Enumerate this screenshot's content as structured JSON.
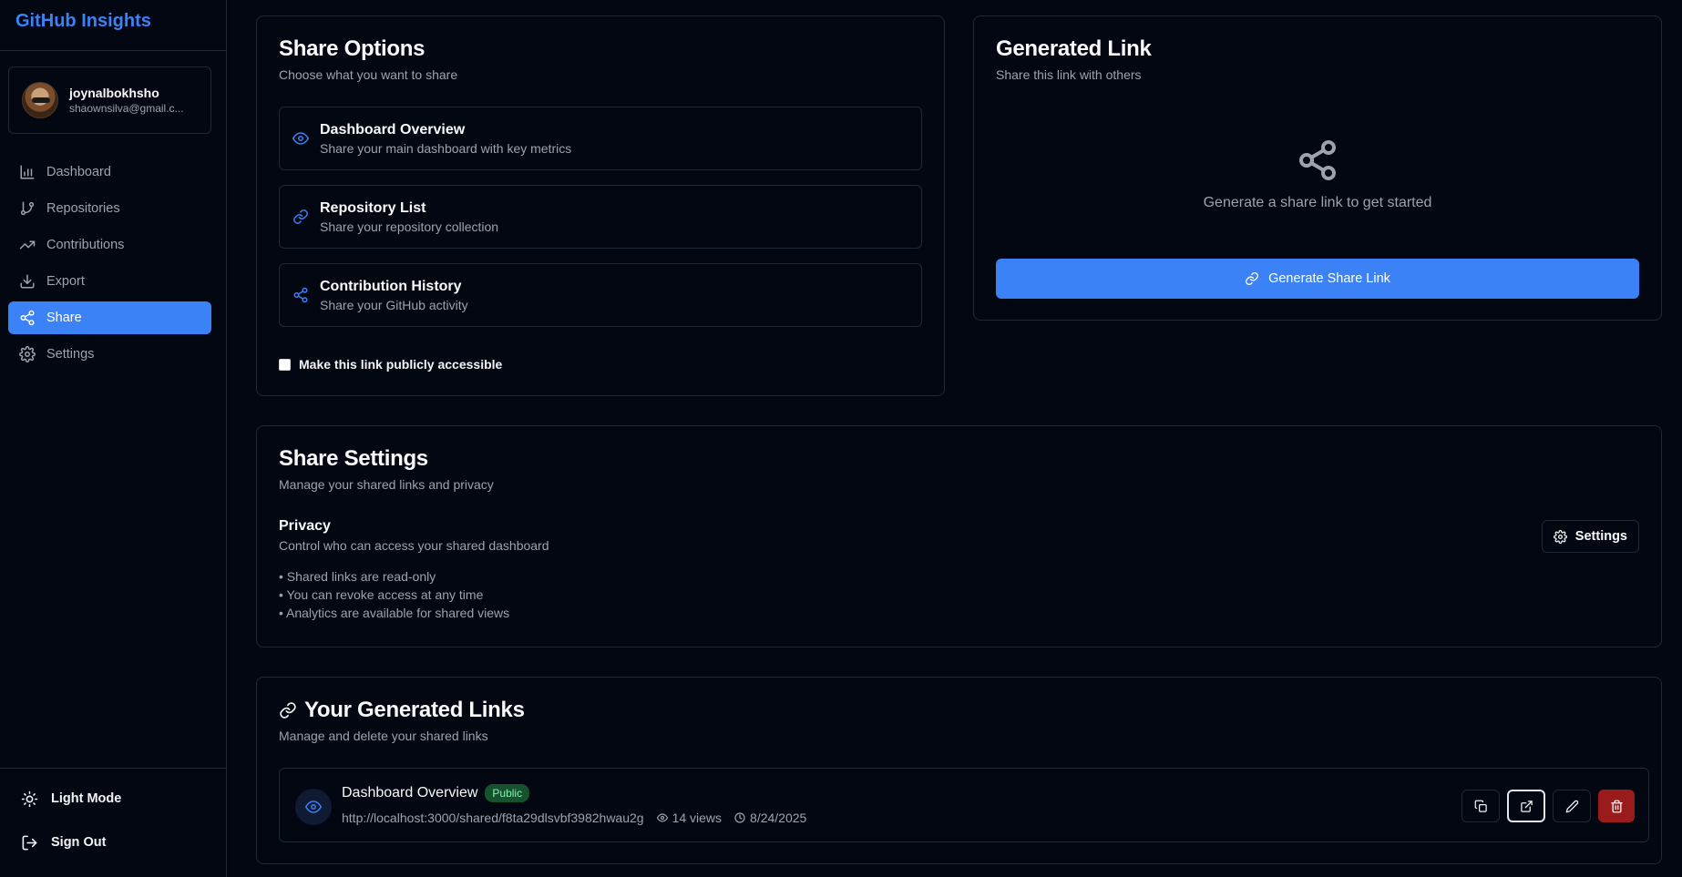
{
  "app": {
    "title": "GitHub Insights"
  },
  "user": {
    "name": "joynalbokhsho",
    "email": "shaownsilva@gmail.c..."
  },
  "nav": {
    "items": [
      {
        "label": "Dashboard",
        "icon": "bar-chart-icon",
        "active": false
      },
      {
        "label": "Repositories",
        "icon": "git-branch-icon",
        "active": false
      },
      {
        "label": "Contributions",
        "icon": "trending-up-icon",
        "active": false
      },
      {
        "label": "Export",
        "icon": "download-icon",
        "active": false
      },
      {
        "label": "Share",
        "icon": "share-icon",
        "active": true
      },
      {
        "label": "Settings",
        "icon": "gear-icon",
        "active": false
      }
    ]
  },
  "sidebar_bottom": {
    "theme_label": "Light Mode",
    "signout_label": "Sign Out"
  },
  "share_options": {
    "title": "Share Options",
    "subtitle": "Choose what you want to share",
    "options": [
      {
        "title": "Dashboard Overview",
        "desc": "Share your main dashboard with key metrics",
        "icon": "eye-icon"
      },
      {
        "title": "Repository List",
        "desc": "Share your repository collection",
        "icon": "link-icon"
      },
      {
        "title": "Contribution History",
        "desc": "Share your GitHub activity",
        "icon": "share-icon"
      }
    ],
    "public_checkbox_label": "Make this link publicly accessible"
  },
  "generated_link": {
    "title": "Generated Link",
    "subtitle": "Share this link with others",
    "empty_text": "Generate a share link to get started",
    "button_label": "Generate Share Link"
  },
  "share_settings": {
    "title": "Share Settings",
    "subtitle": "Manage your shared links and privacy",
    "privacy_title": "Privacy",
    "privacy_desc": "Control who can access your shared dashboard",
    "bullets": [
      "• Shared links are read-only",
      "• You can revoke access at any time",
      "• Analytics are available for shared views"
    ],
    "settings_button": "Settings"
  },
  "your_links": {
    "title": "Your Generated Links",
    "subtitle": "Manage and delete your shared links",
    "links": [
      {
        "title": "Dashboard Overview",
        "badge": "Public",
        "url": "http://localhost:3000/shared/f8ta29dlsvbf3982hwau2g",
        "views": "14 views",
        "date": "8/24/2025"
      }
    ]
  },
  "colors": {
    "accent": "#3b82f6",
    "background": "#030712",
    "border": "#1f2937",
    "danger": "#991b1b",
    "badge_bg": "#14532d"
  }
}
